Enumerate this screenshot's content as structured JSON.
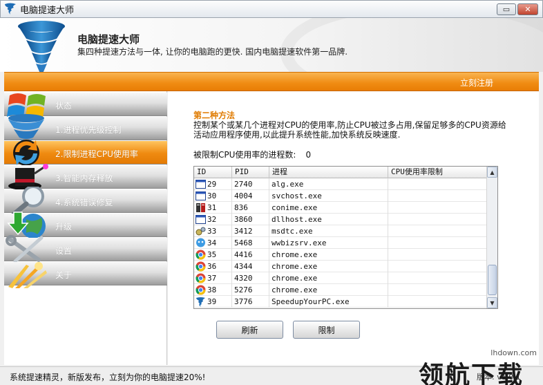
{
  "window": {
    "title": "电脑提速大师",
    "minimize_label": "▭",
    "close_label": "✕"
  },
  "header": {
    "title": "电脑提速大师",
    "subtitle": "集四种提速方法与一体, 让你的电脑跑的更快. 国内电脑提速软件第一品牌."
  },
  "topbar": {
    "register_label": "立刻注册"
  },
  "sidebar": {
    "items": [
      {
        "label": "状态",
        "icon": "windows-logo-icon"
      },
      {
        "label": "1.进程优先级控制",
        "icon": "tornado-icon"
      },
      {
        "label": "2.限制进程CPU使用率",
        "icon": "refresh-arrows-icon",
        "active": true
      },
      {
        "label": "3.智能内存释放",
        "icon": "magic-hat-icon"
      },
      {
        "label": "4.系统错误修复",
        "icon": "magnifier-icon"
      },
      {
        "label": "升级",
        "icon": "download-globe-icon"
      },
      {
        "label": "设置",
        "icon": "tools-icon"
      },
      {
        "label": "关于",
        "icon": "light-rays-icon"
      }
    ]
  },
  "main": {
    "section_title": "第二种方法",
    "description": "控制某个或某几个进程对CPU的使用率,防止CPU被过多占用,保留足够多的CPU资源给活动应用程序使用,以此提升系统性能,加快系统反映速度.",
    "count_label": "被限制CPU使用率的进程数:",
    "count_value": "0",
    "table": {
      "columns": [
        "ID",
        "PID",
        "进程",
        "CPU使用率限制"
      ],
      "rows": [
        {
          "id": "29",
          "pid": "2740",
          "process": "alg.exe",
          "limit": "",
          "icon": "window-icon"
        },
        {
          "id": "30",
          "pid": "4004",
          "process": "svchost.exe",
          "limit": "",
          "icon": "window-icon"
        },
        {
          "id": "31",
          "pid": "836",
          "process": "conime.exe",
          "limit": "",
          "icon": "keyboard-icon"
        },
        {
          "id": "32",
          "pid": "3860",
          "process": "dllhost.exe",
          "limit": "",
          "icon": "window-icon"
        },
        {
          "id": "33",
          "pid": "3412",
          "process": "msdtc.exe",
          "limit": "",
          "icon": "gears-icon"
        },
        {
          "id": "34",
          "pid": "5468",
          "process": "wwbizsrv.exe",
          "limit": "",
          "icon": "chat-bubble-icon"
        },
        {
          "id": "35",
          "pid": "4416",
          "process": "chrome.exe",
          "limit": "",
          "icon": "chrome-icon"
        },
        {
          "id": "36",
          "pid": "4344",
          "process": "chrome.exe",
          "limit": "",
          "icon": "chrome-icon"
        },
        {
          "id": "37",
          "pid": "4320",
          "process": "chrome.exe",
          "limit": "",
          "icon": "chrome-icon"
        },
        {
          "id": "38",
          "pid": "5276",
          "process": "chrome.exe",
          "limit": "",
          "icon": "chrome-icon"
        },
        {
          "id": "39",
          "pid": "3776",
          "process": "SpeedupYourPC.exe",
          "limit": "",
          "icon": "tornado-icon"
        }
      ]
    },
    "buttons": {
      "refresh": "刷新",
      "limit": "限制"
    }
  },
  "statusbar": {
    "text": "系统提速精灵，新版发布，立刻为你的电脑提速20%!",
    "version": "版本: v1.0.1"
  },
  "watermark": {
    "url": "lhdown.com",
    "text": "领航下载"
  },
  "colors": {
    "accent_orange": "#f08b12",
    "title_orange": "#e07b00"
  }
}
